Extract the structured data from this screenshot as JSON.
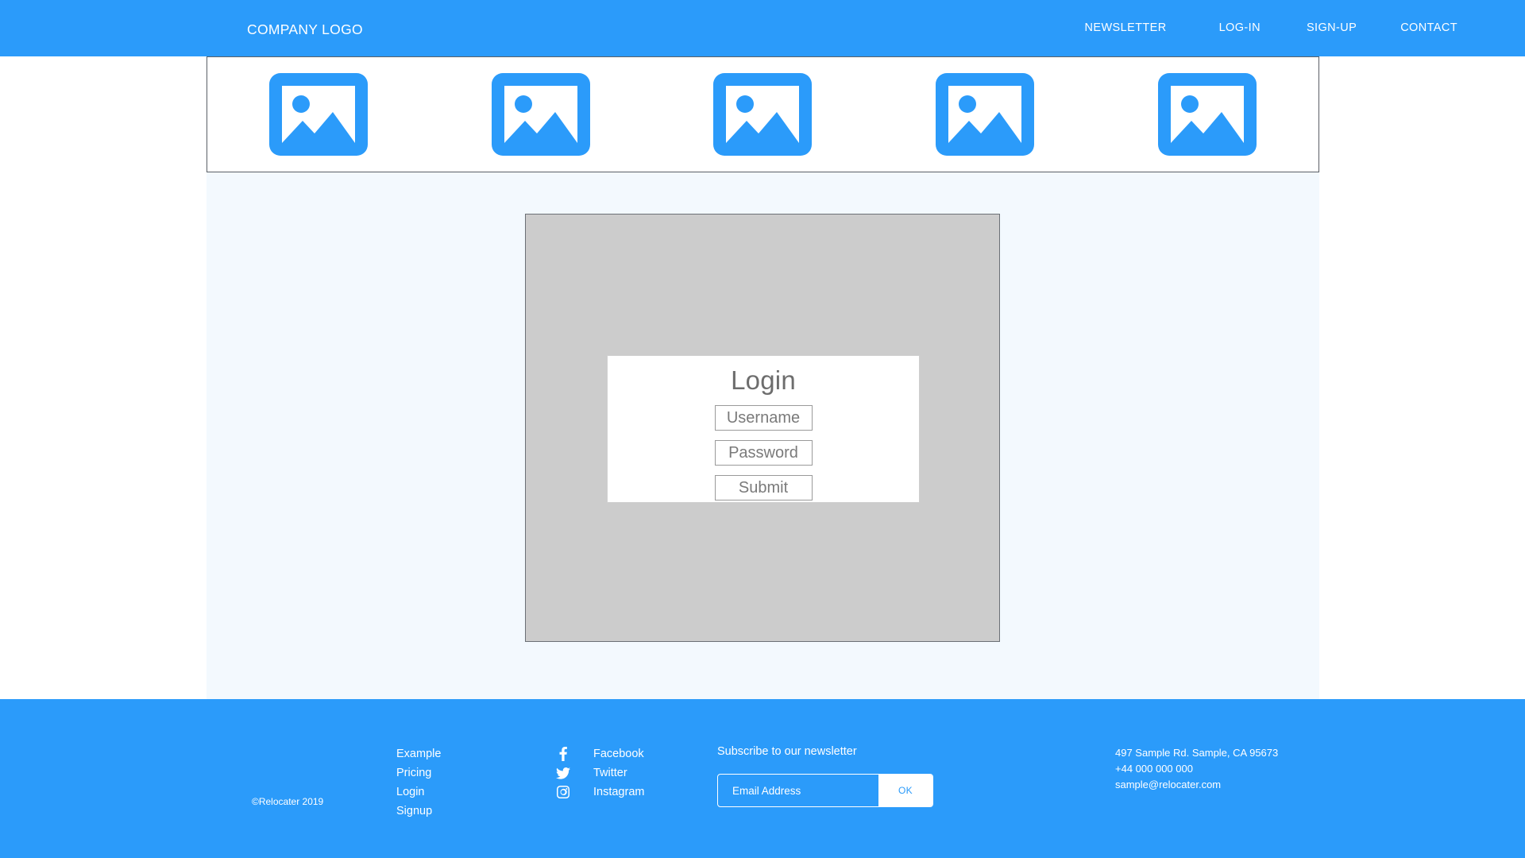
{
  "header": {
    "logo": "COMPANY LOGO",
    "nav": [
      {
        "label": "NEWSLETTER",
        "name": "nav-newsletter"
      },
      {
        "label": "LOG-IN",
        "name": "nav-log-in"
      },
      {
        "label": "SIGN-UP",
        "name": "nav-sign-up"
      },
      {
        "label": "CONTACT",
        "name": "nav-contact"
      }
    ]
  },
  "gallery": {
    "icon": "image-placeholder-icon",
    "count": 5
  },
  "main": {
    "login": {
      "title": "Login",
      "username_placeholder": "Username",
      "password_placeholder": "Password",
      "submit_label": "Submit"
    }
  },
  "footer": {
    "copyright": "©Relocater 2019",
    "links": [
      {
        "label": "Example"
      },
      {
        "label": "Pricing"
      },
      {
        "label": "Login"
      },
      {
        "label": "Signup"
      }
    ],
    "social": [
      {
        "label": "Facebook",
        "icon": "facebook-icon"
      },
      {
        "label": "Twitter",
        "icon": "twitter-icon"
      },
      {
        "label": "Instagram",
        "icon": "instagram-icon"
      }
    ],
    "newsletter": {
      "title": "Subscribe to our newsletter",
      "placeholder": "Email Address",
      "ok_label": "OK"
    },
    "contact": [
      {
        "line": "497 Sample Rd. Sample, CA 95673"
      },
      {
        "line": "+44 000 000 000"
      },
      {
        "line": "sample@relocater.com"
      }
    ]
  },
  "colors": {
    "brand_blue": "#2b9bfa",
    "main_bg": "#f3f9fe",
    "panel_gray": "#cccccc",
    "border_gray": "#5a5f66"
  }
}
